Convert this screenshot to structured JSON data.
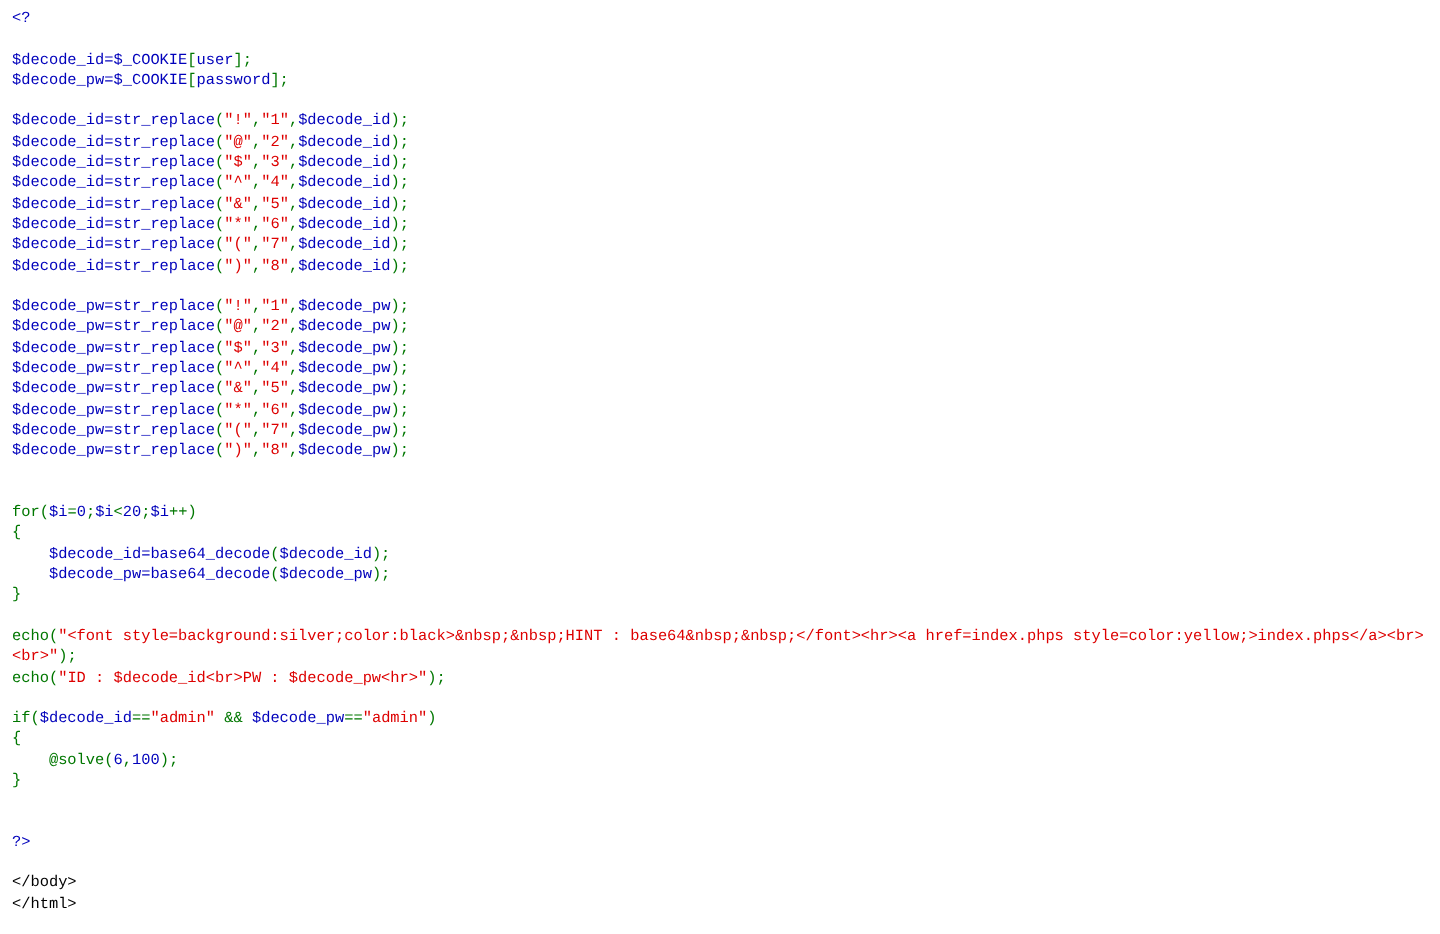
{
  "source_lines": [
    {
      "kind": "code",
      "tokens": [
        {
          "text": "<?",
          "kind": "php"
        }
      ]
    },
    {
      "kind": "blank"
    },
    {
      "kind": "code",
      "tokens": [
        {
          "text": "$decode_id=$_COOKIE",
          "kind": "php"
        },
        {
          "text": "[",
          "kind": "syntax"
        },
        {
          "text": "user",
          "kind": "php"
        },
        {
          "text": "];",
          "kind": "syntax"
        }
      ]
    },
    {
      "kind": "code",
      "tokens": [
        {
          "text": "$decode_pw=$_COOKIE",
          "kind": "php"
        },
        {
          "text": "[",
          "kind": "syntax"
        },
        {
          "text": "password",
          "kind": "php"
        },
        {
          "text": "];",
          "kind": "syntax"
        }
      ]
    },
    {
      "kind": "blank"
    },
    {
      "kind": "code",
      "tokens": [
        {
          "text": "$decode_id=str_replace",
          "kind": "php"
        },
        {
          "text": "(",
          "kind": "syntax"
        },
        {
          "text": "\"!\"",
          "kind": "string"
        },
        {
          "text": ",",
          "kind": "syntax"
        },
        {
          "text": "\"1\"",
          "kind": "string"
        },
        {
          "text": ",",
          "kind": "syntax"
        },
        {
          "text": "$decode_id",
          "kind": "php"
        },
        {
          "text": ");",
          "kind": "syntax"
        }
      ]
    },
    {
      "kind": "code",
      "tokens": [
        {
          "text": "$decode_id=str_replace",
          "kind": "php"
        },
        {
          "text": "(",
          "kind": "syntax"
        },
        {
          "text": "\"@\"",
          "kind": "string"
        },
        {
          "text": ",",
          "kind": "syntax"
        },
        {
          "text": "\"2\"",
          "kind": "string"
        },
        {
          "text": ",",
          "kind": "syntax"
        },
        {
          "text": "$decode_id",
          "kind": "php"
        },
        {
          "text": ");",
          "kind": "syntax"
        }
      ]
    },
    {
      "kind": "code",
      "tokens": [
        {
          "text": "$decode_id=str_replace",
          "kind": "php"
        },
        {
          "text": "(",
          "kind": "syntax"
        },
        {
          "text": "\"$\"",
          "kind": "string"
        },
        {
          "text": ",",
          "kind": "syntax"
        },
        {
          "text": "\"3\"",
          "kind": "string"
        },
        {
          "text": ",",
          "kind": "syntax"
        },
        {
          "text": "$decode_id",
          "kind": "php"
        },
        {
          "text": ");",
          "kind": "syntax"
        }
      ]
    },
    {
      "kind": "code",
      "tokens": [
        {
          "text": "$decode_id=str_replace",
          "kind": "php"
        },
        {
          "text": "(",
          "kind": "syntax"
        },
        {
          "text": "\"^\"",
          "kind": "string"
        },
        {
          "text": ",",
          "kind": "syntax"
        },
        {
          "text": "\"4\"",
          "kind": "string"
        },
        {
          "text": ",",
          "kind": "syntax"
        },
        {
          "text": "$decode_id",
          "kind": "php"
        },
        {
          "text": ");",
          "kind": "syntax"
        }
      ]
    },
    {
      "kind": "code",
      "tokens": [
        {
          "text": "$decode_id=str_replace",
          "kind": "php"
        },
        {
          "text": "(",
          "kind": "syntax"
        },
        {
          "text": "\"&\"",
          "kind": "string"
        },
        {
          "text": ",",
          "kind": "syntax"
        },
        {
          "text": "\"5\"",
          "kind": "string"
        },
        {
          "text": ",",
          "kind": "syntax"
        },
        {
          "text": "$decode_id",
          "kind": "php"
        },
        {
          "text": ");",
          "kind": "syntax"
        }
      ]
    },
    {
      "kind": "code",
      "tokens": [
        {
          "text": "$decode_id=str_replace",
          "kind": "php"
        },
        {
          "text": "(",
          "kind": "syntax"
        },
        {
          "text": "\"*\"",
          "kind": "string"
        },
        {
          "text": ",",
          "kind": "syntax"
        },
        {
          "text": "\"6\"",
          "kind": "string"
        },
        {
          "text": ",",
          "kind": "syntax"
        },
        {
          "text": "$decode_id",
          "kind": "php"
        },
        {
          "text": ");",
          "kind": "syntax"
        }
      ]
    },
    {
      "kind": "code",
      "tokens": [
        {
          "text": "$decode_id=str_replace",
          "kind": "php"
        },
        {
          "text": "(",
          "kind": "syntax"
        },
        {
          "text": "\"(\"",
          "kind": "string"
        },
        {
          "text": ",",
          "kind": "syntax"
        },
        {
          "text": "\"7\"",
          "kind": "string"
        },
        {
          "text": ",",
          "kind": "syntax"
        },
        {
          "text": "$decode_id",
          "kind": "php"
        },
        {
          "text": ");",
          "kind": "syntax"
        }
      ]
    },
    {
      "kind": "code",
      "tokens": [
        {
          "text": "$decode_id=str_replace",
          "kind": "php"
        },
        {
          "text": "(",
          "kind": "syntax"
        },
        {
          "text": "\")\"",
          "kind": "string"
        },
        {
          "text": ",",
          "kind": "syntax"
        },
        {
          "text": "\"8\"",
          "kind": "string"
        },
        {
          "text": ",",
          "kind": "syntax"
        },
        {
          "text": "$decode_id",
          "kind": "php"
        },
        {
          "text": ");",
          "kind": "syntax"
        }
      ]
    },
    {
      "kind": "blank"
    },
    {
      "kind": "code",
      "tokens": [
        {
          "text": "$decode_pw=str_replace",
          "kind": "php"
        },
        {
          "text": "(",
          "kind": "syntax"
        },
        {
          "text": "\"!\"",
          "kind": "string"
        },
        {
          "text": ",",
          "kind": "syntax"
        },
        {
          "text": "\"1\"",
          "kind": "string"
        },
        {
          "text": ",",
          "kind": "syntax"
        },
        {
          "text": "$decode_pw",
          "kind": "php"
        },
        {
          "text": ");",
          "kind": "syntax"
        }
      ]
    },
    {
      "kind": "code",
      "tokens": [
        {
          "text": "$decode_pw=str_replace",
          "kind": "php"
        },
        {
          "text": "(",
          "kind": "syntax"
        },
        {
          "text": "\"@\"",
          "kind": "string"
        },
        {
          "text": ",",
          "kind": "syntax"
        },
        {
          "text": "\"2\"",
          "kind": "string"
        },
        {
          "text": ",",
          "kind": "syntax"
        },
        {
          "text": "$decode_pw",
          "kind": "php"
        },
        {
          "text": ");",
          "kind": "syntax"
        }
      ]
    },
    {
      "kind": "code",
      "tokens": [
        {
          "text": "$decode_pw=str_replace",
          "kind": "php"
        },
        {
          "text": "(",
          "kind": "syntax"
        },
        {
          "text": "\"$\"",
          "kind": "string"
        },
        {
          "text": ",",
          "kind": "syntax"
        },
        {
          "text": "\"3\"",
          "kind": "string"
        },
        {
          "text": ",",
          "kind": "syntax"
        },
        {
          "text": "$decode_pw",
          "kind": "php"
        },
        {
          "text": ");",
          "kind": "syntax"
        }
      ]
    },
    {
      "kind": "code",
      "tokens": [
        {
          "text": "$decode_pw=str_replace",
          "kind": "php"
        },
        {
          "text": "(",
          "kind": "syntax"
        },
        {
          "text": "\"^\"",
          "kind": "string"
        },
        {
          "text": ",",
          "kind": "syntax"
        },
        {
          "text": "\"4\"",
          "kind": "string"
        },
        {
          "text": ",",
          "kind": "syntax"
        },
        {
          "text": "$decode_pw",
          "kind": "php"
        },
        {
          "text": ");",
          "kind": "syntax"
        }
      ]
    },
    {
      "kind": "code",
      "tokens": [
        {
          "text": "$decode_pw=str_replace",
          "kind": "php"
        },
        {
          "text": "(",
          "kind": "syntax"
        },
        {
          "text": "\"&\"",
          "kind": "string"
        },
        {
          "text": ",",
          "kind": "syntax"
        },
        {
          "text": "\"5\"",
          "kind": "string"
        },
        {
          "text": ",",
          "kind": "syntax"
        },
        {
          "text": "$decode_pw",
          "kind": "php"
        },
        {
          "text": ");",
          "kind": "syntax"
        }
      ]
    },
    {
      "kind": "code",
      "tokens": [
        {
          "text": "$decode_pw=str_replace",
          "kind": "php"
        },
        {
          "text": "(",
          "kind": "syntax"
        },
        {
          "text": "\"*\"",
          "kind": "string"
        },
        {
          "text": ",",
          "kind": "syntax"
        },
        {
          "text": "\"6\"",
          "kind": "string"
        },
        {
          "text": ",",
          "kind": "syntax"
        },
        {
          "text": "$decode_pw",
          "kind": "php"
        },
        {
          "text": ");",
          "kind": "syntax"
        }
      ]
    },
    {
      "kind": "code",
      "tokens": [
        {
          "text": "$decode_pw=str_replace",
          "kind": "php"
        },
        {
          "text": "(",
          "kind": "syntax"
        },
        {
          "text": "\"(\"",
          "kind": "string"
        },
        {
          "text": ",",
          "kind": "syntax"
        },
        {
          "text": "\"7\"",
          "kind": "string"
        },
        {
          "text": ",",
          "kind": "syntax"
        },
        {
          "text": "$decode_pw",
          "kind": "php"
        },
        {
          "text": ");",
          "kind": "syntax"
        }
      ]
    },
    {
      "kind": "code",
      "tokens": [
        {
          "text": "$decode_pw=str_replace",
          "kind": "php"
        },
        {
          "text": "(",
          "kind": "syntax"
        },
        {
          "text": "\")\"",
          "kind": "string"
        },
        {
          "text": ",",
          "kind": "syntax"
        },
        {
          "text": "\"8\"",
          "kind": "string"
        },
        {
          "text": ",",
          "kind": "syntax"
        },
        {
          "text": "$decode_pw",
          "kind": "php"
        },
        {
          "text": ");",
          "kind": "syntax"
        }
      ]
    },
    {
      "kind": "blank"
    },
    {
      "kind": "blank"
    },
    {
      "kind": "code",
      "tokens": [
        {
          "text": "for(",
          "kind": "syntax"
        },
        {
          "text": "$i",
          "kind": "php"
        },
        {
          "text": "=",
          "kind": "syntax"
        },
        {
          "text": "0",
          "kind": "php"
        },
        {
          "text": ";",
          "kind": "syntax"
        },
        {
          "text": "$i",
          "kind": "php"
        },
        {
          "text": "<",
          "kind": "syntax"
        },
        {
          "text": "20",
          "kind": "php"
        },
        {
          "text": ";",
          "kind": "syntax"
        },
        {
          "text": "$i",
          "kind": "php"
        },
        {
          "text": "++)",
          "kind": "syntax"
        }
      ]
    },
    {
      "kind": "code",
      "tokens": [
        {
          "text": "{",
          "kind": "syntax"
        }
      ]
    },
    {
      "kind": "code",
      "tokens": [
        {
          "text": "    $decode_id=base64_decode",
          "kind": "php"
        },
        {
          "text": "(",
          "kind": "syntax"
        },
        {
          "text": "$decode_id",
          "kind": "php"
        },
        {
          "text": ");",
          "kind": "syntax"
        }
      ]
    },
    {
      "kind": "code",
      "tokens": [
        {
          "text": "    $decode_pw=base64_decode",
          "kind": "php"
        },
        {
          "text": "(",
          "kind": "syntax"
        },
        {
          "text": "$decode_pw",
          "kind": "php"
        },
        {
          "text": ");",
          "kind": "syntax"
        }
      ]
    },
    {
      "kind": "code",
      "tokens": [
        {
          "text": "}",
          "kind": "syntax"
        }
      ]
    },
    {
      "kind": "blank"
    },
    {
      "kind": "code",
      "tokens": [
        {
          "text": "echo(",
          "kind": "syntax"
        },
        {
          "text": "\"<font style=background:silver;color:black>&nbsp;&nbsp;HINT : base64&nbsp;&nbsp;</font><hr><a href=index.phps style=color:yellow;>index.phps</a><br>",
          "kind": "string"
        }
      ]
    },
    {
      "kind": "code",
      "tokens": [
        {
          "text": "<br>\"",
          "kind": "string"
        },
        {
          "text": ");",
          "kind": "syntax"
        }
      ]
    },
    {
      "kind": "code",
      "tokens": [
        {
          "text": "echo(",
          "kind": "syntax"
        },
        {
          "text": "\"ID : $decode_id<br>PW : $decode_pw<hr>\"",
          "kind": "string"
        },
        {
          "text": ");",
          "kind": "syntax"
        }
      ]
    },
    {
      "kind": "blank"
    },
    {
      "kind": "code",
      "tokens": [
        {
          "text": "if(",
          "kind": "syntax"
        },
        {
          "text": "$decode_id",
          "kind": "php"
        },
        {
          "text": "==",
          "kind": "syntax"
        },
        {
          "text": "\"admin\"",
          "kind": "string"
        },
        {
          "text": " && ",
          "kind": "syntax"
        },
        {
          "text": "$decode_pw",
          "kind": "php"
        },
        {
          "text": "==",
          "kind": "syntax"
        },
        {
          "text": "\"admin\"",
          "kind": "string"
        },
        {
          "text": ")",
          "kind": "syntax"
        }
      ]
    },
    {
      "kind": "code",
      "tokens": [
        {
          "text": "{",
          "kind": "syntax"
        }
      ]
    },
    {
      "kind": "code",
      "tokens": [
        {
          "text": "    @solve",
          "kind": "syntax"
        },
        {
          "text": "(",
          "kind": "syntax"
        },
        {
          "text": "6",
          "kind": "php"
        },
        {
          "text": ",",
          "kind": "syntax"
        },
        {
          "text": "100",
          "kind": "php"
        },
        {
          "text": ");",
          "kind": "syntax"
        }
      ]
    },
    {
      "kind": "code",
      "tokens": [
        {
          "text": "}",
          "kind": "syntax"
        }
      ]
    },
    {
      "kind": "blank"
    },
    {
      "kind": "blank"
    },
    {
      "kind": "code",
      "tokens": [
        {
          "text": "?>",
          "kind": "php"
        }
      ]
    },
    {
      "kind": "blank"
    },
    {
      "kind": "code",
      "tokens": [
        {
          "text": "</body>",
          "kind": "html"
        }
      ]
    },
    {
      "kind": "code",
      "tokens": [
        {
          "text": "</html>",
          "kind": "html"
        }
      ]
    }
  ]
}
